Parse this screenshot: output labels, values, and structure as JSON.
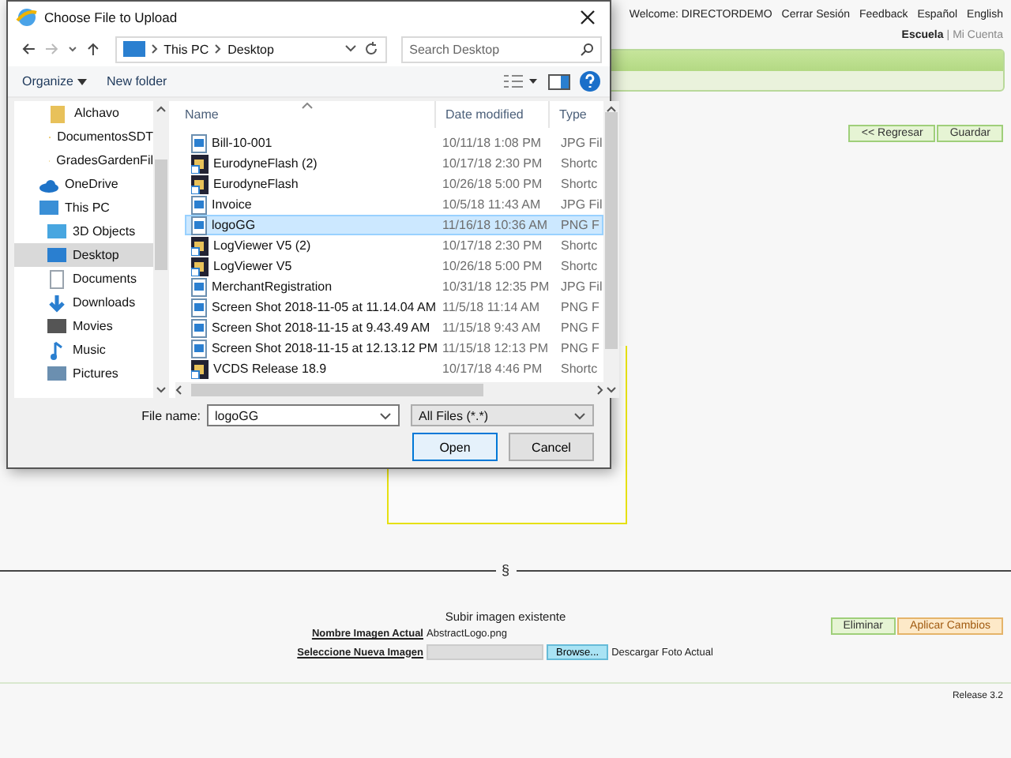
{
  "page": {
    "top_links": [
      "Welcome: DIRECTORDEMO",
      "Cerrar Sesión",
      "Feedback",
      "Español",
      "English"
    ],
    "account": {
      "school": "Escuela",
      "separator": "|",
      "my_account": "Mi Cuenta"
    },
    "nav_buttons": [
      "<< Regresar",
      "Guardar"
    ],
    "divider_mark": "§",
    "upload": {
      "heading": "Subir imagen existente",
      "current_label": "Nombre Imagen Actual",
      "current_value": "AbstractLogo.png",
      "select_label": "Seleccione Nueva Imagen",
      "browse": "Browse...",
      "download": "Descargar Foto Actual"
    },
    "action_buttons": [
      {
        "label": "Eliminar",
        "kind": "green"
      },
      {
        "label": "Aplicar Cambios",
        "kind": "orange"
      }
    ],
    "release": "Release 3.2"
  },
  "dialog": {
    "title": "Choose File to Upload",
    "path": [
      "This PC",
      "Desktop"
    ],
    "search": {
      "placeholder": "Search Desktop"
    },
    "toolbar": [
      "Organize",
      "New folder"
    ],
    "nav_items": [
      {
        "label": "Alchavo",
        "kind": "folder",
        "selected": false
      },
      {
        "label": "DocumentosSDT",
        "kind": "folder",
        "selected": false
      },
      {
        "label": "GradesGardenFil",
        "kind": "folder",
        "selected": false
      },
      {
        "label": "OneDrive",
        "kind": "cloud",
        "selected": false
      },
      {
        "label": "This PC",
        "kind": "pc",
        "selected": false,
        "children": [
          {
            "label": "3D Objects",
            "kind": "cube",
            "selected": false
          },
          {
            "label": "Desktop",
            "kind": "desktop",
            "selected": true
          },
          {
            "label": "Documents",
            "kind": "document",
            "selected": false
          },
          {
            "label": "Downloads",
            "kind": "download",
            "selected": false
          },
          {
            "label": "Movies",
            "kind": "film",
            "selected": false
          },
          {
            "label": "Music",
            "kind": "music",
            "selected": false
          },
          {
            "label": "Pictures",
            "kind": "picturefolder",
            "selected": false
          }
        ]
      }
    ],
    "columns": [
      "Name",
      "Date modified",
      "Type"
    ],
    "files": [
      {
        "name": "Bill-10-001",
        "date": "10/11/18 1:08 PM",
        "type": "JPG Fil",
        "kind": "image",
        "selected": false
      },
      {
        "name": "EurodyneFlash (2)",
        "date": "10/17/18 2:30 PM",
        "type": "Shortc",
        "kind": "shortcut",
        "selected": false
      },
      {
        "name": "EurodyneFlash",
        "date": "10/26/18 5:00 PM",
        "type": "Shortc",
        "kind": "shortcut",
        "selected": false
      },
      {
        "name": "Invoice",
        "date": "10/5/18 11:43 AM",
        "type": "JPG Fil",
        "kind": "image",
        "selected": false
      },
      {
        "name": "logoGG",
        "date": "11/16/18 10:36 AM",
        "type": "PNG F",
        "kind": "image",
        "selected": true
      },
      {
        "name": "LogViewer V5 (2)",
        "date": "10/17/18 2:30 PM",
        "type": "Shortc",
        "kind": "shortcut",
        "selected": false
      },
      {
        "name": "LogViewer V5",
        "date": "10/26/18 5:00 PM",
        "type": "Shortc",
        "kind": "shortcut",
        "selected": false
      },
      {
        "name": "MerchantRegistration",
        "date": "10/31/18 12:35 PM",
        "type": "JPG Fil",
        "kind": "image",
        "selected": false
      },
      {
        "name": "Screen Shot 2018-11-05 at 11.14.04 AM",
        "date": "11/5/18 11:14 AM",
        "type": "PNG F",
        "kind": "image",
        "selected": false
      },
      {
        "name": "Screen Shot 2018-11-15 at 9.43.49 AM",
        "date": "11/15/18 9:43 AM",
        "type": "PNG F",
        "kind": "image",
        "selected": false
      },
      {
        "name": "Screen Shot 2018-11-15 at 12.13.12 PM",
        "date": "11/15/18 12:13 PM",
        "type": "PNG F",
        "kind": "image",
        "selected": false
      },
      {
        "name": "VCDS Release 18.9",
        "date": "10/17/18 4:46 PM",
        "type": "Shortc",
        "kind": "shortcut",
        "selected": false
      }
    ],
    "file_name_label": "File name:",
    "file_name": "logoGG",
    "filter": "All Files (*.*)",
    "buttons": [
      "Open",
      "Cancel"
    ]
  }
}
